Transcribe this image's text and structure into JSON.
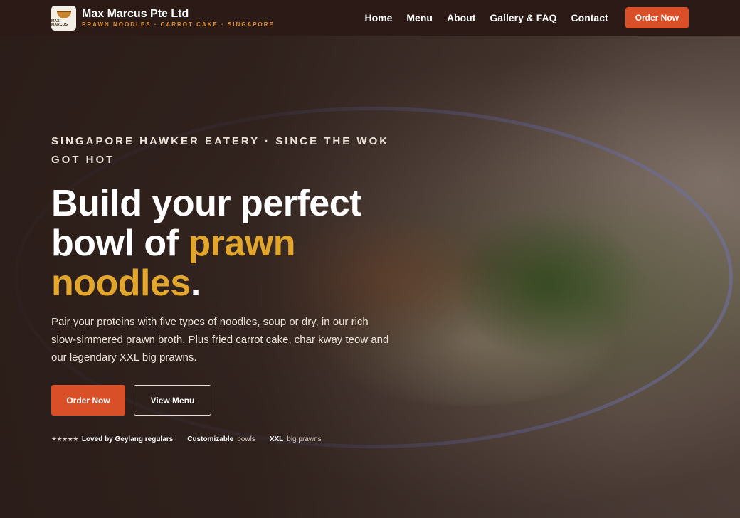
{
  "brand": {
    "logo_text": "MAX MARCUS",
    "name": "Max Marcus Pte Ltd",
    "tagline": "PRAWN NOODLES · CARROT CAKE · SINGAPORE"
  },
  "nav": {
    "items": [
      {
        "label": "Home"
      },
      {
        "label": "Menu"
      },
      {
        "label": "About"
      },
      {
        "label": "Gallery & FAQ"
      },
      {
        "label": "Contact"
      }
    ],
    "cta_label": "Order Now"
  },
  "hero": {
    "eyebrow": "SINGAPORE HAWKER EATERY · SINCE THE WOK GOT HOT",
    "headline_line1": "Build your perfect",
    "headline_line2_start": "bowl of ",
    "headline_accent_1": "prawn",
    "headline_accent_2": "noodles",
    "headline_end": ".",
    "subtext": "Pair your proteins with five types of noodles, soup or dry, in our rich slow-simmered prawn broth. Plus fried carrot cake, char kway teow and our legendary XXL big prawns.",
    "primary_button": "Order Now",
    "secondary_button": "View Menu"
  },
  "badges": [
    {
      "stars": "★★★★★",
      "strong": "Loved by Geylang regulars"
    },
    {
      "strong": "Customizable",
      "soft": "bowls"
    },
    {
      "strong": "XXL",
      "soft": "big prawns"
    }
  ],
  "colors": {
    "header_bg": "#2b1a15",
    "accent_orange": "#d94f27",
    "accent_gold": "#e3a62c",
    "tagline_orange": "#e0932a"
  }
}
